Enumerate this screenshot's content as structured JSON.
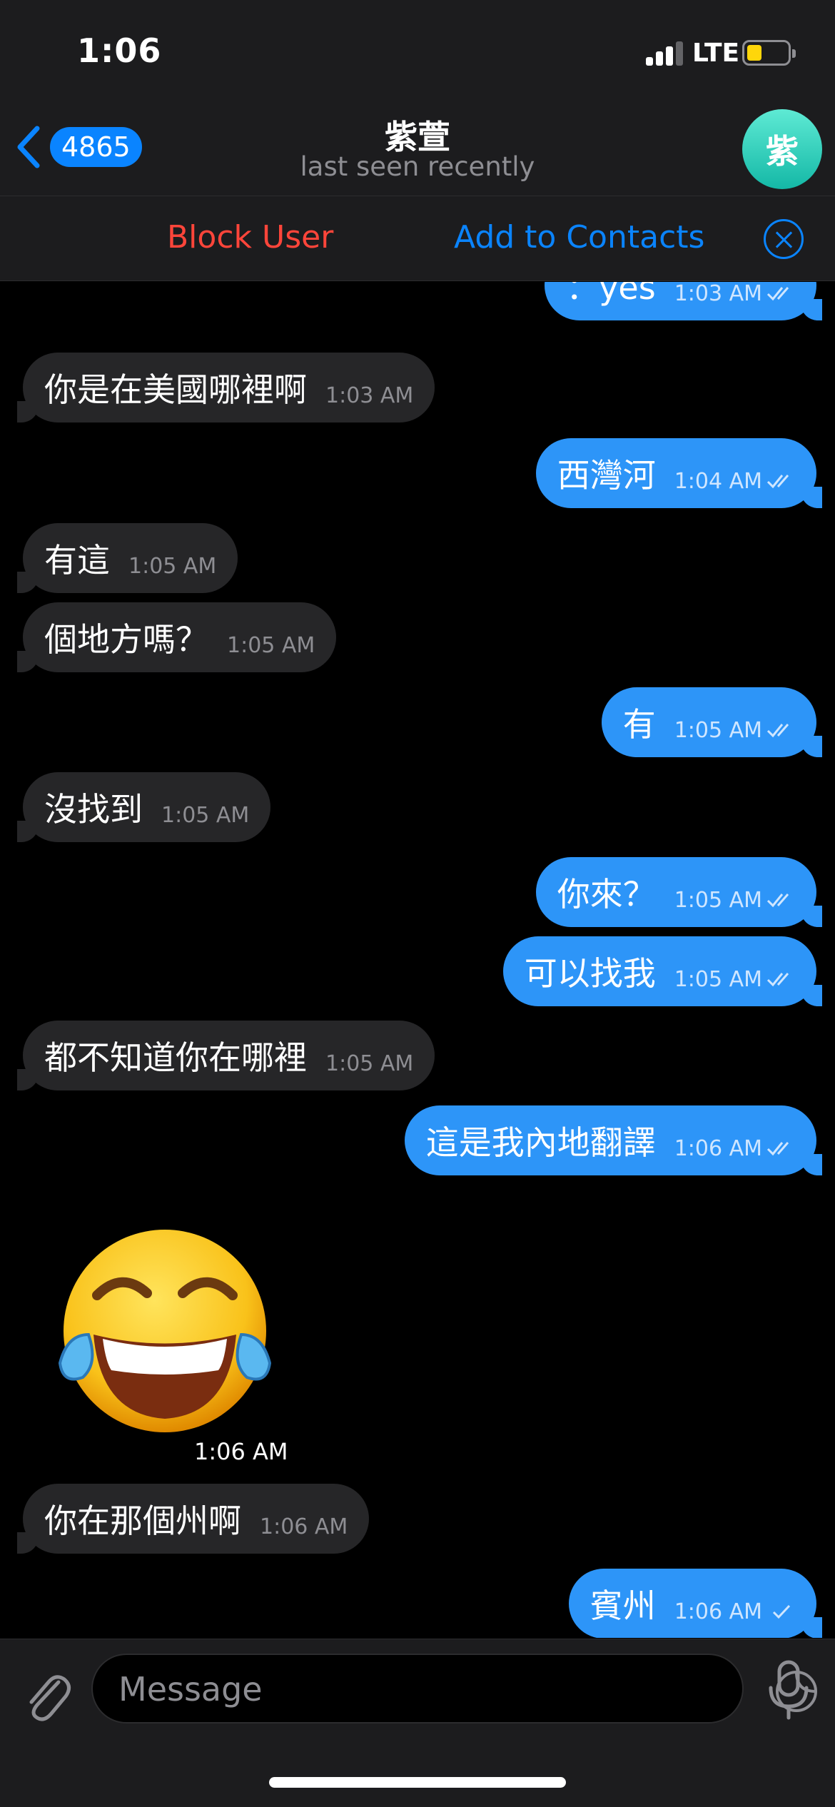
{
  "status_bar": {
    "time": "1:06",
    "network": "LTE"
  },
  "header": {
    "unread_count": "4865",
    "title": "紫萱",
    "subtitle": "last seen recently",
    "avatar_initial": "紫"
  },
  "action_bar": {
    "block_label": "Block User",
    "add_label": "Add to Contacts"
  },
  "messages": [
    {
      "dir": "out",
      "text": "：yes",
      "time": "1:03 AM",
      "read": true
    },
    {
      "dir": "in",
      "text": "你是在美國哪裡啊",
      "time": "1:03 AM"
    },
    {
      "dir": "out",
      "text": "西灣河",
      "time": "1:04 AM",
      "read": true
    },
    {
      "dir": "in",
      "text": "有這",
      "time": "1:05 AM"
    },
    {
      "dir": "in",
      "text": "個地方嗎？",
      "time": "1:05 AM"
    },
    {
      "dir": "out",
      "text": "有",
      "time": "1:05 AM",
      "read": true
    },
    {
      "dir": "in",
      "text": "沒找到",
      "time": "1:05 AM"
    },
    {
      "dir": "out",
      "text": "你來？",
      "time": "1:05 AM",
      "read": true
    },
    {
      "dir": "out",
      "text": "可以找我",
      "time": "1:05 AM",
      "read": true
    },
    {
      "dir": "in",
      "text": "都不知道你在哪裡",
      "time": "1:05 AM"
    },
    {
      "dir": "out",
      "text": "這是我內地翻譯",
      "time": "1:06 AM",
      "read": true
    },
    {
      "dir": "in",
      "text": "你在那個州啊",
      "time": "1:06 AM"
    },
    {
      "dir": "out",
      "text": "賓州",
      "time": "1:06 AM",
      "read": false
    }
  ],
  "sticker": {
    "icon": "laughing-tears-emoji",
    "time": "1:06 AM"
  },
  "composer": {
    "placeholder": "Message"
  },
  "colors": {
    "accent": "#0a84ff",
    "outgoing": "#2d95f8",
    "incoming": "#262628",
    "danger": "#ff453a"
  }
}
